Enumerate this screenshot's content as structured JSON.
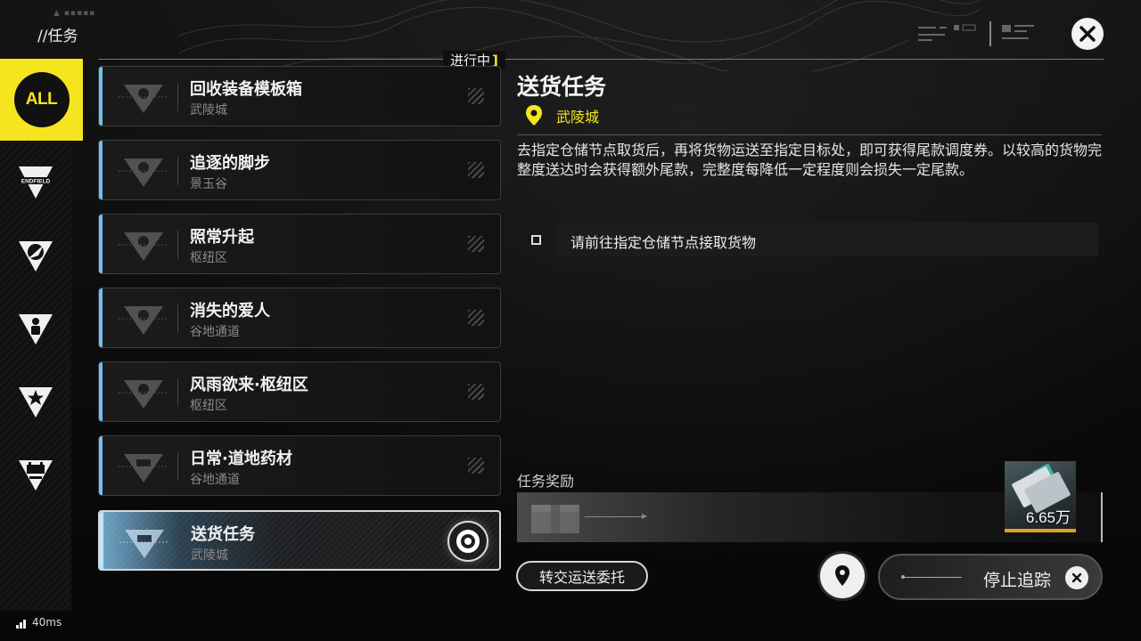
{
  "header": {
    "title": "//任务",
    "section_label": "进行中"
  },
  "categories": [
    {
      "name": "all",
      "label": "ALL",
      "selected": true
    },
    {
      "name": "endfield",
      "label": "ENDFIELD",
      "selected": false
    },
    {
      "name": "category-2",
      "label": "",
      "selected": false
    },
    {
      "name": "category-3",
      "label": "",
      "selected": false
    },
    {
      "name": "category-4",
      "label": "",
      "selected": false
    },
    {
      "name": "category-5",
      "label": "",
      "selected": false
    }
  ],
  "quests": [
    {
      "title": "回收装备模板箱",
      "location": "武陵城",
      "active": false
    },
    {
      "title": "追逐的脚步",
      "location": "景玉谷",
      "active": false
    },
    {
      "title": "照常升起",
      "location": "枢纽区",
      "active": false
    },
    {
      "title": "消失的爱人",
      "location": "谷地通道",
      "active": false
    },
    {
      "title": "风雨欲来·枢纽区",
      "location": "枢纽区",
      "active": false
    },
    {
      "title": "日常·道地药材",
      "location": "谷地通道",
      "active": false
    },
    {
      "title": "送货任务",
      "location": "武陵城",
      "active": true
    }
  ],
  "detail": {
    "title": "送货任务",
    "location": "武陵城",
    "description": "去指定仓储节点取货后，再将货物运送至指定目标处，即可获得尾款调度券。以较高的货物完整度送达时会获得额外尾款，完整度每降低一定程度则会损失一定尾款。",
    "objective": "请前往指定仓储节点接取货物",
    "reward_label": "任务奖励",
    "reward_quantity": "6.65万"
  },
  "actions": {
    "transfer": "转交运送委托",
    "stop_tracking": "停止追踪"
  },
  "status": {
    "ping": "40ms"
  },
  "colors": {
    "accent_yellow": "#f5e51e",
    "accent_blue": "#6ec1f0",
    "reward_gold": "#e0a21c"
  }
}
